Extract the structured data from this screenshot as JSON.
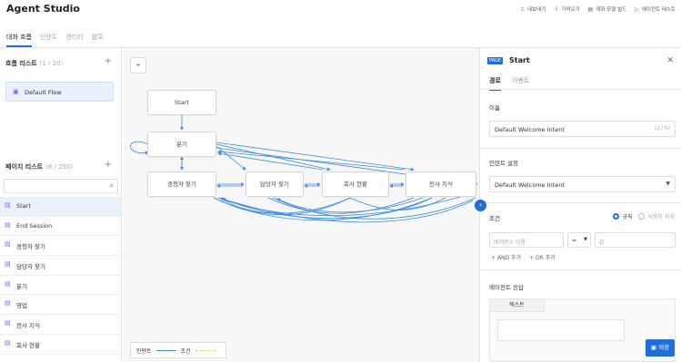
{
  "app": {
    "title": "Agent Studio"
  },
  "top_actions": [
    {
      "icon": "export-icon",
      "glyph": "⇪",
      "label": "내보내기"
    },
    {
      "icon": "import-icon",
      "glyph": "⇩",
      "label": "가져오기"
    },
    {
      "icon": "build-icon",
      "glyph": "▤",
      "label": "대화 모델 빌드"
    },
    {
      "icon": "test-icon",
      "glyph": "▷",
      "label": "에이전트 테스트"
    }
  ],
  "tabs": [
    {
      "label": "대화 흐름",
      "active": true
    },
    {
      "label": "인텐트",
      "active": false
    },
    {
      "label": "엔티티",
      "active": false
    },
    {
      "label": "웹훅",
      "active": false
    }
  ],
  "flow_list": {
    "title": "흐름 리스트",
    "count": "(1 / 20)",
    "items": [
      "Default Flow"
    ]
  },
  "page_list": {
    "title": "페이지 리스트",
    "count": "(8 / 250)",
    "items": [
      "Start",
      "End Session",
      "경청자 찾기",
      "담당자 찾기",
      "분기",
      "영업",
      "전사 지식",
      "회사 현황"
    ],
    "selected": "Start"
  },
  "graph": {
    "nodes": {
      "start": "Start",
      "branch": "분기",
      "n1": "경청자 찾기",
      "n2": "담당자 찾기",
      "n3": "회사 현황",
      "n4": "전사 지식"
    },
    "legend": {
      "intent": "인텐트",
      "condition": "조건"
    }
  },
  "panel": {
    "badge": "PAGE",
    "title": "Start",
    "tabs": [
      "경로",
      "이벤트"
    ],
    "name_label": "이름",
    "name_value": "Default Welcome Intent",
    "name_count": "22 / 50",
    "intent_label": "인텐트 설정",
    "intent_value": "Default Welcome Intent",
    "condition_label": "조건",
    "radio_rule": "규칙",
    "radio_custom": "사용자 지정",
    "cond_param_placeholder": "매개변수 이름",
    "cond_op": "=",
    "cond_value_placeholder": "값",
    "and_add": "AND 추가",
    "or_add": "OR 추가",
    "response_label": "에이전트 응답",
    "response_tab": "텍스트",
    "save": "저장"
  },
  "colors": {
    "accent": "#1e6fd9",
    "intent_line": "#3b8be6",
    "condition_line": "#e5cf6c",
    "page_icon": "#8b5cf6"
  }
}
